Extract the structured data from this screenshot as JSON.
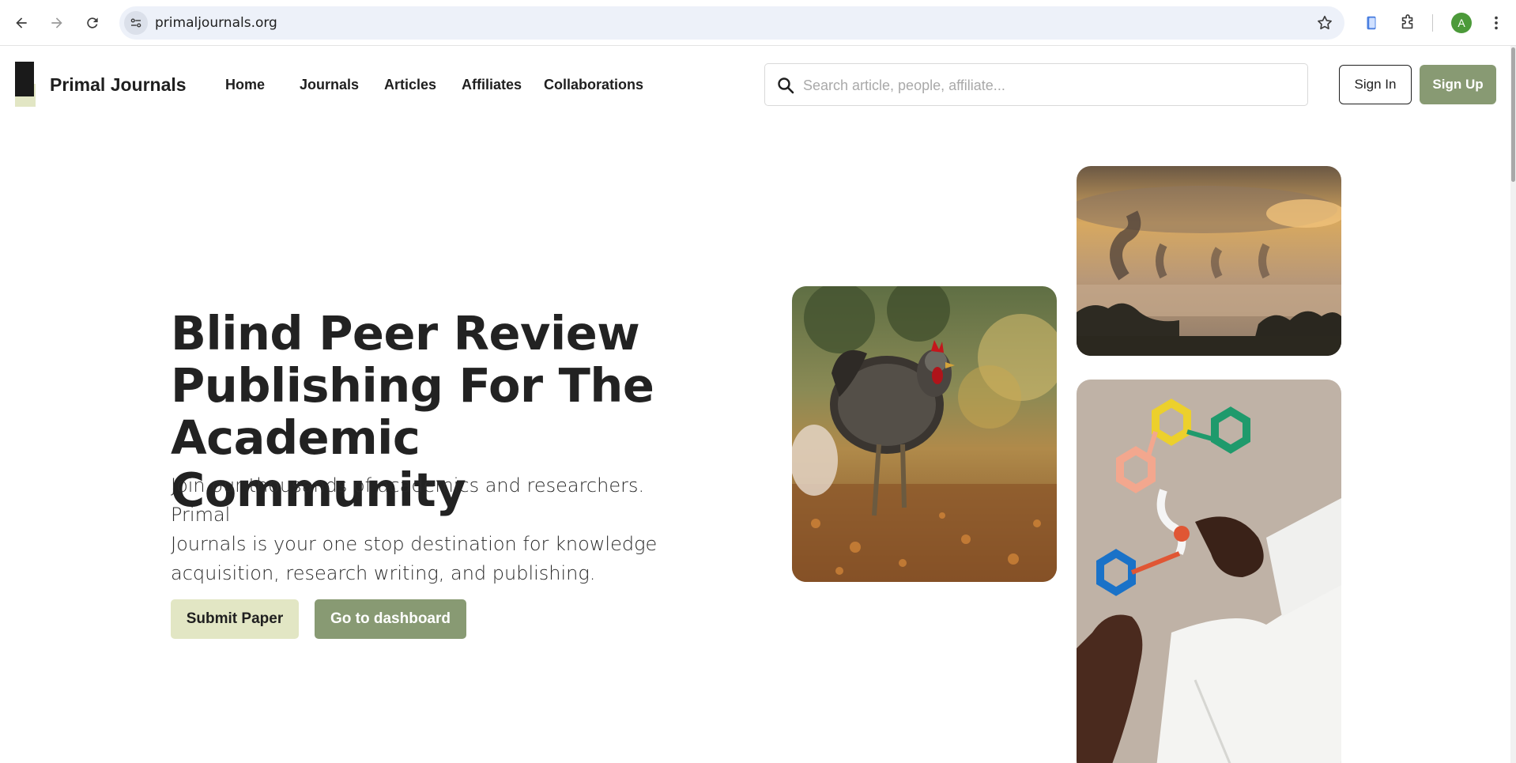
{
  "browser": {
    "url": "primaljournals.org",
    "profile_initial": "A",
    "profile_color": "#4c9a3a"
  },
  "site": {
    "brand": "Primal Journals",
    "nav": [
      "Home",
      "Journals",
      "Articles",
      "Affiliates",
      "Collaborations"
    ],
    "search_placeholder": "Search article, people, affiliate...",
    "sign_in": "Sign In",
    "sign_up": "Sign Up"
  },
  "hero": {
    "title_lines": [
      "Blind Peer Review",
      "Publishing For The",
      "Academic Community"
    ],
    "subtitle_lines": [
      "Join our thousands of academics and researchers. Primal",
      "Journals is your one stop destination for knowledge",
      "acquisition, research writing, and publishing."
    ],
    "primary_button": "Submit Paper",
    "secondary_button": "Go to dashboard"
  },
  "images": [
    {
      "subject": "rooster",
      "icon": "rooster-photo"
    },
    {
      "subject": "factory smoke at sunset",
      "icon": "factory-photo"
    },
    {
      "subject": "molecule model in hands",
      "icon": "molecule-photo"
    }
  ],
  "colors": {
    "accent_green": "#889a73",
    "accent_cream": "#e2e6c4",
    "text_dark": "#222222"
  }
}
